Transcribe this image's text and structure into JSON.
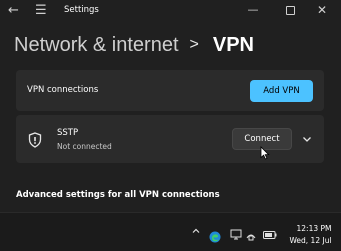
{
  "window": {
    "title": "Settings",
    "back_icon": "back-arrow-icon",
    "menu_icon": "hamburger-menu-icon",
    "controls": [
      "minimize-icon",
      "maximize-icon",
      "close-icon"
    ]
  },
  "breadcrumb": {
    "parent": "Network & internet",
    "separator": ">",
    "current": "VPN"
  },
  "vpn_connections": {
    "label": "VPN connections",
    "add_button": "Add VPN"
  },
  "connections": [
    {
      "name": "SSTP",
      "status": "Not connected",
      "connect_button": "Connect",
      "icon": "shield-icon"
    }
  ],
  "advanced": {
    "title": "Advanced settings for all VPN connections"
  },
  "taskbar": {
    "time": "12:13 PM",
    "date": "Wed, 12 Jul",
    "tray_icons": [
      "chevron-up-icon",
      "edge-icon",
      "display-icon",
      "network-icon",
      "battery-icon"
    ]
  },
  "colors": {
    "accent": "#4cc2ff",
    "background": "#202020",
    "card": "#2b2b2b"
  }
}
